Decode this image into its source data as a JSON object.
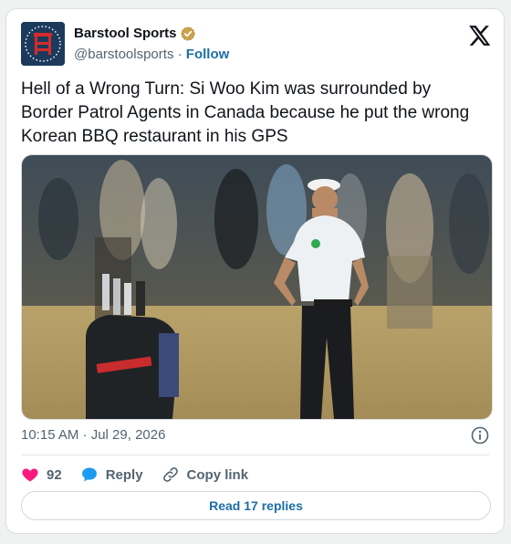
{
  "account": {
    "display_name": "Barstool Sports",
    "handle": "@barstoolsports",
    "separator": " · ",
    "follow_label": "Follow"
  },
  "tweet": {
    "text": "Hell of a Wrong Turn: Si Woo Kim was surrounded by Border Patrol Agents in Canada because he put the wrong Korean BBQ restaurant in his GPS",
    "timestamp": "10:15 AM · Jul 29, 2026"
  },
  "actions": {
    "like_count": "92",
    "reply_label": "Reply",
    "copy_link_label": "Copy link"
  },
  "read_replies_label": "Read 17 replies",
  "icons": {
    "like": "heart-icon",
    "reply": "speech-bubble-icon",
    "copy": "link-icon",
    "info": "info-icon",
    "brand": "x-logo-icon",
    "verified": "verified-badge-icon"
  },
  "colors": {
    "like": "#f91880",
    "reply": "#1d9bf0",
    "link": "#1d6fa5",
    "verified": "#c9a24a",
    "avatar_bg": "#1c3a5b"
  }
}
